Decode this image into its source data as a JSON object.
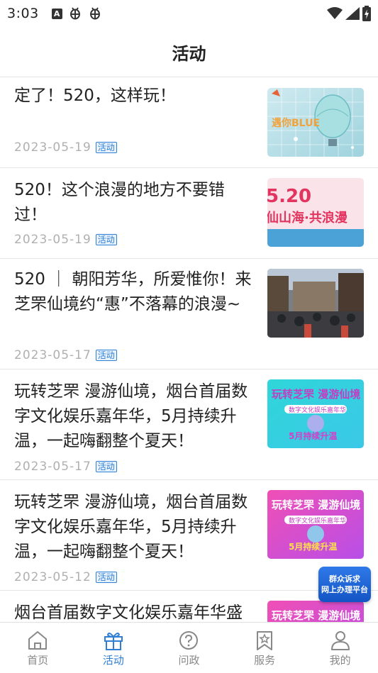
{
  "status_bar": {
    "time": "3:03",
    "notification_icons": [
      "a-icon",
      "bug-icon",
      "bug-icon"
    ],
    "right_icons": [
      "wifi-icon",
      "signal-icon",
      "battery-icon"
    ]
  },
  "header": {
    "title": "活动"
  },
  "articles": [
    {
      "title": "定了！520，这样玩！",
      "date": "2023-05-19",
      "tag": "活动",
      "thumb_text": "遇你BLUE"
    },
    {
      "title": "520！这个浪漫的地方不要错过！",
      "date": "2023-05-19",
      "tag": "活动",
      "thumb_text_1": "5.20",
      "thumb_text_2": "仙山海·共浪漫"
    },
    {
      "title": "520 ｜ 朝阳芳华，所爱惟你！来芝罘仙境约“惠”不落幕的浪漫~",
      "date": "2023-05-17",
      "tag": "活动"
    },
    {
      "title": "玩转芝罘 漫游仙境，烟台首届数字文化娱乐嘉年华，5月持续升温，一起嗨翻整个夏天！",
      "date": "2023-05-17",
      "tag": "活动",
      "thumb_text_1": "玩转芝罘 漫游仙境",
      "thumb_text_2": "数字文化娱乐嘉年华",
      "thumb_text_3": "5月持续升温"
    },
    {
      "title": "玩转芝罘 漫游仙境，烟台首届数字文化娱乐嘉年华，5月持续升温，一起嗨翻整个夏天！",
      "date": "2023-05-12",
      "tag": "活动",
      "thumb_text_1": "玩转芝罘 漫游仙境",
      "thumb_text_2": "数字文化娱乐嘉年华",
      "thumb_text_3": "5月持续升温"
    },
    {
      "title": "烟台首届数字文化娱乐嘉年华盛",
      "thumb_text_1": "玩转芝罘 漫游仙境"
    }
  ],
  "float_badge": {
    "line1": "群众诉求",
    "line2": "网上办理平台"
  },
  "tabbar": {
    "active": "活动",
    "tabs": [
      {
        "label": "首页",
        "icon": "home-icon"
      },
      {
        "label": "活动",
        "icon": "gift-icon"
      },
      {
        "label": "问政",
        "icon": "question-icon"
      },
      {
        "label": "服务",
        "icon": "bookmark-star-icon"
      },
      {
        "label": "我的",
        "icon": "person-icon"
      }
    ]
  },
  "colors": {
    "accent": "#2f7fd4",
    "inactive": "#888888",
    "date": "#b0b0b0"
  }
}
